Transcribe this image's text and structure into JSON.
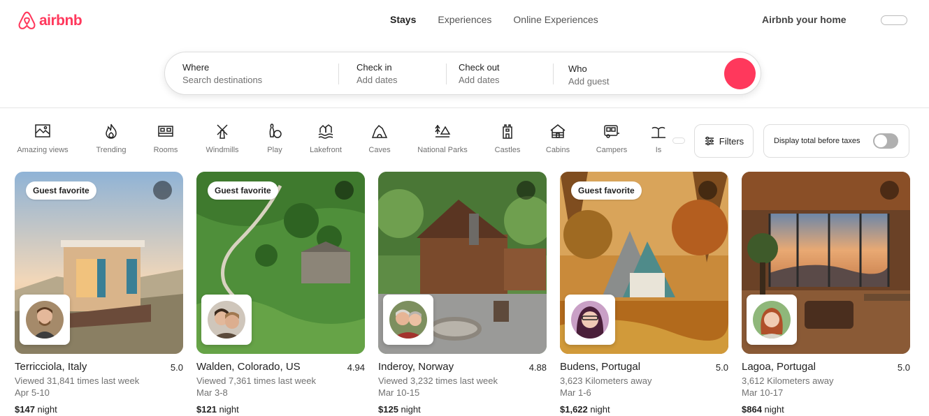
{
  "brand": {
    "name": "airbnb",
    "color": "#ff385c"
  },
  "nav": {
    "tabs": [
      {
        "label": "Stays",
        "active": true
      },
      {
        "label": "Experiences",
        "active": false
      },
      {
        "label": "Online Experiences",
        "active": false
      }
    ],
    "host_link": "Airbnb your home"
  },
  "search": {
    "where": {
      "label": "Where",
      "placeholder": "Search destinations"
    },
    "check_in": {
      "label": "Check in",
      "placeholder": "Add dates"
    },
    "check_out": {
      "label": "Check out",
      "placeholder": "Add dates"
    },
    "who": {
      "label": "Who",
      "placeholder": "Add guest"
    }
  },
  "categories": [
    {
      "label": "Amazing views",
      "icon": "amazing-views-icon"
    },
    {
      "label": "Trending",
      "icon": "flame-icon"
    },
    {
      "label": "Rooms",
      "icon": "bed-icon"
    },
    {
      "label": "Windmills",
      "icon": "windmill-icon"
    },
    {
      "label": "Play",
      "icon": "bowling-icon"
    },
    {
      "label": "Lakefront",
      "icon": "lakefront-icon"
    },
    {
      "label": "Caves",
      "icon": "cave-icon"
    },
    {
      "label": "National Parks",
      "icon": "national-parks-icon"
    },
    {
      "label": "Castles",
      "icon": "castle-icon"
    },
    {
      "label": "Cabins",
      "icon": "cabin-icon"
    },
    {
      "label": "Campers",
      "icon": "camper-icon"
    },
    {
      "label": "Is",
      "icon": "island-icon"
    }
  ],
  "filters": {
    "label": "Filters"
  },
  "taxes": {
    "label": "Display total before taxes",
    "enabled": false
  },
  "listings": [
    {
      "title": "Terricciola, Italy",
      "rating": "5.0",
      "sub": "Viewed 31,841 times last week",
      "dates": "Apr 5-10",
      "price": "$147",
      "unit": "night",
      "badge": "Guest favorite"
    },
    {
      "title": "Walden, Colorado, US",
      "rating": "4.94",
      "sub": "Viewed 7,361 times last week",
      "dates": "Mar 3-8",
      "price": "$121",
      "unit": "night",
      "badge": "Guest favorite"
    },
    {
      "title": "Inderoy, Norway",
      "rating": "4.88",
      "sub": "Viewed 3,232 times last week",
      "dates": "Mar 10-15",
      "price": "$125",
      "unit": "night",
      "badge": ""
    },
    {
      "title": "Budens, Portugal",
      "rating": "5.0",
      "sub": "3,623 Kilometers away",
      "dates": "Mar 1-6",
      "price": "$1,622",
      "unit": "night",
      "badge": "Guest favorite"
    },
    {
      "title": "Lagoa, Portugal",
      "rating": "5.0",
      "sub": "3,612 Kilometers away",
      "dates": "Mar 10-17",
      "price": "$864",
      "unit": "night",
      "badge": ""
    }
  ]
}
